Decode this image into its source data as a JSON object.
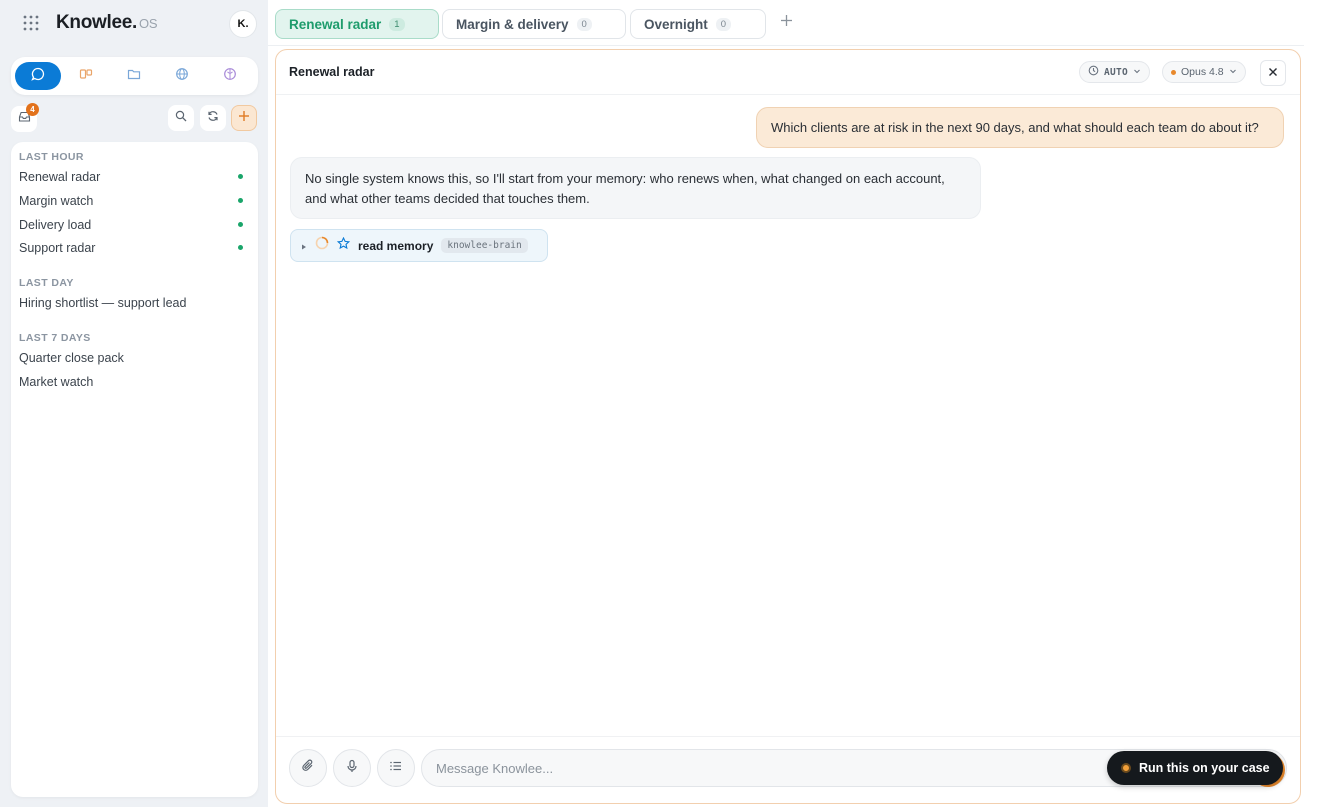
{
  "app": {
    "brand": "Knowlee",
    "brand_suffix": ".",
    "brand_os": "OS",
    "avatar_initial": "K."
  },
  "sidebar": {
    "mode_icons": [
      "chat-icon",
      "board-icon",
      "folder-icon",
      "globe-icon",
      "brain-icon"
    ],
    "inbox_badge": "4",
    "sections": [
      {
        "title": "LAST HOUR",
        "items": [
          {
            "label": "Renewal radar",
            "live": true
          },
          {
            "label": "Margin watch",
            "live": true
          },
          {
            "label": "Delivery load",
            "live": true
          },
          {
            "label": "Support radar",
            "live": true
          }
        ]
      },
      {
        "title": "LAST DAY",
        "items": [
          {
            "label": "Hiring shortlist — support lead",
            "live": false
          }
        ]
      },
      {
        "title": "LAST 7 DAYS",
        "items": [
          {
            "label": "Quarter close pack",
            "live": false
          },
          {
            "label": "Market watch",
            "live": false
          }
        ]
      }
    ]
  },
  "tabs": [
    {
      "label": "Renewal radar",
      "count": "1",
      "active": true
    },
    {
      "label": "Margin & delivery",
      "count": "0",
      "active": false
    },
    {
      "label": "Overnight",
      "count": "0",
      "active": false
    }
  ],
  "panel": {
    "title": "Renewal radar",
    "mode_pill": "AUTO",
    "model_pill": "Opus 4.8"
  },
  "messages": {
    "user": "Which clients are at risk in the next 90 days, and what should each team do about it?",
    "assistant": "No single system knows this, so I'll start from your memory: who renews when, what changed on each account, and what other teams decided that touches them."
  },
  "tool_call": {
    "name": "read memory",
    "source": "knowlee-brain"
  },
  "composer": {
    "placeholder": "Message Knowlee..."
  },
  "cta": {
    "label": "Run this on your case"
  },
  "colors": {
    "accent_blue": "#0b7bd6",
    "accent_green": "#1e9c6c",
    "accent_orange": "#e8892c"
  }
}
